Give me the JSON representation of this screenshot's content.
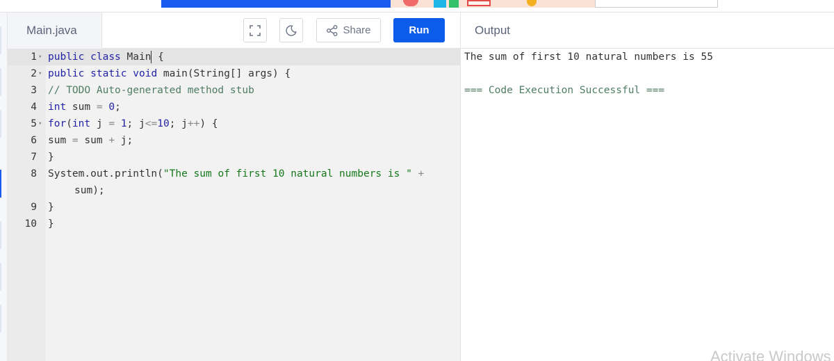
{
  "file_tab": {
    "label": "Main.java"
  },
  "toolbar": {
    "fullscreen_icon": "fullscreen-icon",
    "theme_icon": "moon-icon",
    "share_label": "Share",
    "share_icon": "share-icon",
    "run_label": "Run",
    "run_color": "#0b5ce8"
  },
  "output": {
    "title": "Output",
    "lines": [
      "The sum of first 10 natural numbers is 55",
      "=== Code Execution Successful ==="
    ]
  },
  "editor": {
    "lines": [
      {
        "num": "1",
        "fold": true,
        "text": "public class Main {"
      },
      {
        "num": "2",
        "fold": true,
        "text": "public static void main(String[] args) {"
      },
      {
        "num": "3",
        "fold": false,
        "text": "// TODO Auto-generated method stub"
      },
      {
        "num": "4",
        "fold": false,
        "text": "int sum = 0;"
      },
      {
        "num": "5",
        "fold": true,
        "text": "for(int j = 1; j<=10; j++) {"
      },
      {
        "num": "6",
        "fold": false,
        "text": "sum = sum + j;"
      },
      {
        "num": "7",
        "fold": false,
        "text": "}"
      },
      {
        "num": "8",
        "fold": false,
        "text": "System.out.println(\"The sum of first 10 natural numbers is \" +"
      },
      {
        "num": "",
        "fold": false,
        "text": "sum);"
      },
      {
        "num": "9",
        "fold": false,
        "text": "}"
      },
      {
        "num": "10",
        "fold": false,
        "text": "}"
      }
    ]
  },
  "watermark": "Activate Windows"
}
